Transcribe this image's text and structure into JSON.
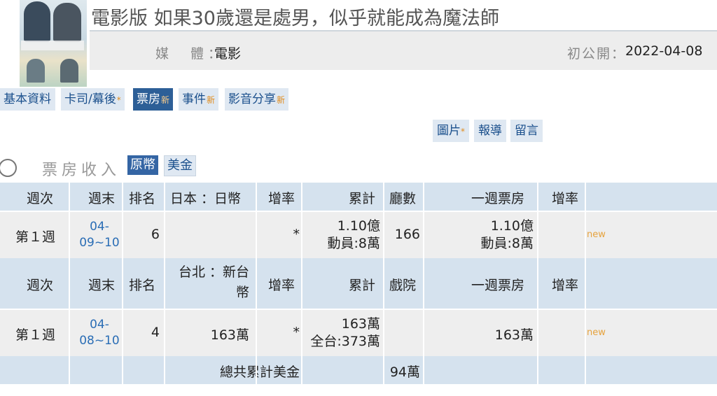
{
  "title": "電影版 如果30歲還是處男，似乎就能成為魔法師",
  "info": {
    "media_label": "媒　體：",
    "media_value": "電影",
    "release_label": "初公開：",
    "release_value": "2022-04-08"
  },
  "tabs": [
    {
      "label": "基本資料",
      "mark": ""
    },
    {
      "label": "卡司/幕後",
      "mark": "*"
    },
    {
      "label": "票房",
      "mark": "新"
    },
    {
      "label": "事件",
      "mark": "新"
    },
    {
      "label": "影音分享",
      "mark": "新"
    }
  ],
  "subtabs": [
    {
      "label": "圖片",
      "mark": "*"
    },
    {
      "label": "報導",
      "mark": ""
    },
    {
      "label": "留言",
      "mark": ""
    }
  ],
  "box_office": {
    "label": "票房收入",
    "currency_options": [
      "原幣",
      "美金"
    ]
  },
  "japan": {
    "headers": {
      "week": "週次",
      "weekend": "週末",
      "rank": "排名",
      "region": "日本 ：日幣",
      "growth": "增率",
      "cumulative": "累計",
      "screens": "廳數",
      "weekly": "一週票房",
      "growth2": "增率"
    },
    "row": {
      "week": "第１週",
      "weekend_a": "04-",
      "weekend_b": "09~10",
      "rank": "6",
      "weekend_gross": "",
      "growth": "*",
      "cum_a": "1.10億",
      "cum_b": "動員:8萬",
      "screens": "166",
      "weekly_a": "1.10億",
      "weekly_b": "動員:8萬",
      "growth2": "new"
    }
  },
  "taipei": {
    "headers": {
      "week": "週次",
      "weekend": "週末",
      "rank": "排名",
      "region_a": "台北 ：新台",
      "region_b": "幣",
      "growth": "增率",
      "cumulative": "累計",
      "screens": "戲院",
      "weekly": "一週票房",
      "growth2": "增率"
    },
    "row": {
      "week": "第１週",
      "weekend_a": "04-",
      "weekend_b": "08~10",
      "rank": "4",
      "weekend_gross": "163萬",
      "growth": "*",
      "cum_a": "163萬",
      "cum_b": "全台:373萬",
      "screens": "",
      "weekly_a": "163萬",
      "weekly_b": "",
      "growth2": "new"
    }
  },
  "total": {
    "label": "總共累計美金",
    "value": "94萬"
  }
}
